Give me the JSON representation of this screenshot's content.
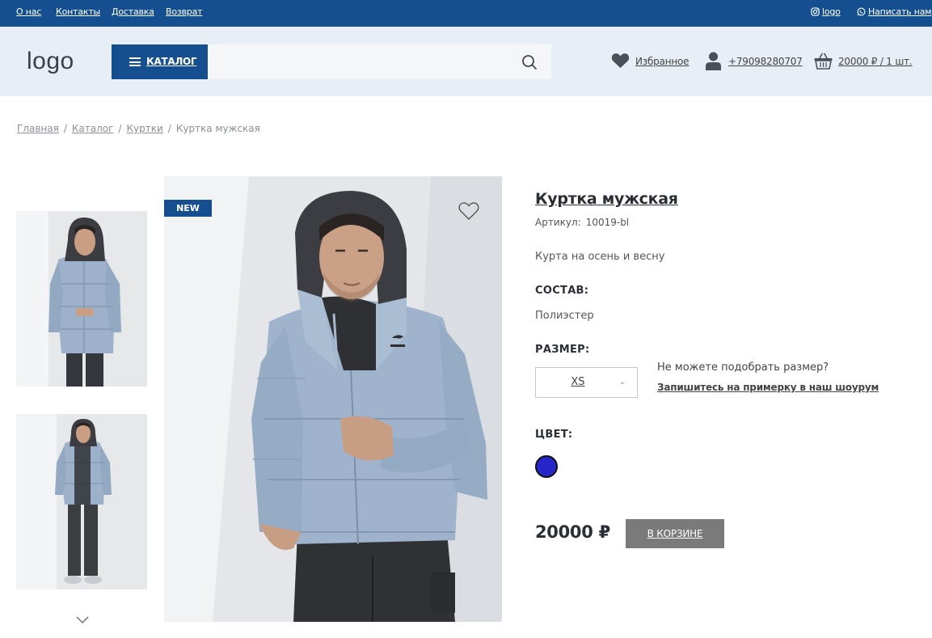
{
  "topbar": {
    "links": [
      "О нас",
      "Контакты",
      "Доставка",
      "Возврат"
    ],
    "instagram_label": "logo",
    "write_us_label": "Написать нам"
  },
  "header": {
    "logo": "logo",
    "catalog_label": "КАТАЛОГ",
    "search_placeholder": "",
    "favorites_label": "Избранное",
    "phone": "+79098280707",
    "cart_label": "20000 ₽ / 1 шт."
  },
  "breadcrumb": {
    "items": [
      "Главная",
      "Каталог",
      "Куртки"
    ],
    "current": "Куртка мужская"
  },
  "gallery": {
    "badge": "NEW"
  },
  "product": {
    "title": "Куртка мужская",
    "article_label": "Артикул:",
    "article_value": "10019-bl",
    "description": "Курта на осень и весну",
    "composition_label": "СОСТАВ:",
    "composition_value": "Полиэстер",
    "size_label": "РАЗМЕР:",
    "size_selected": "XS",
    "size_help": "Не можете подобрать размер?",
    "size_link": "Запишитесь на примерку в наш шоурум",
    "color_label": "ЦВЕТ:",
    "color_value": "#2626c9",
    "price": "20000 ₽",
    "cart_button": "В КОРЗИНЕ"
  },
  "colors": {
    "brand": "#154f8f",
    "header_bg": "#e8eef6",
    "button_gray": "#7a7a7a"
  }
}
